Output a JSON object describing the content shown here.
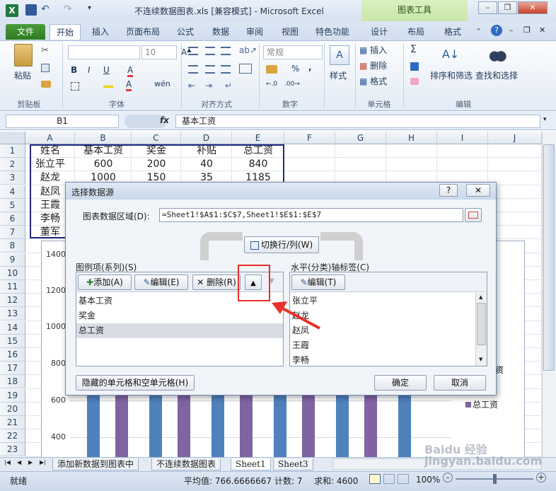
{
  "window": {
    "title": "不连续数据图表.xls  [兼容模式] - Microsoft Excel",
    "context_tab": "图表工具"
  },
  "ribbon_tabs": [
    "文件",
    "开始",
    "插入",
    "页面布局",
    "公式",
    "数据",
    "审阅",
    "视图",
    "特色功能",
    "设计",
    "布局",
    "格式"
  ],
  "ribbon": {
    "clipboard": {
      "paste": "粘贴",
      "label": "剪贴板"
    },
    "font": {
      "size": "10",
      "bold": "B",
      "italic": "I",
      "underline": "U",
      "label": "字体"
    },
    "align": {
      "label": "对齐方式"
    },
    "number": {
      "format": "常规",
      "percent": "%",
      "comma": ",",
      "label": "数字"
    },
    "styles": {
      "label": "样式"
    },
    "cells": {
      "insert": "插入",
      "delete": "删除",
      "format": "格式",
      "label": "单元格"
    },
    "editing": {
      "sum": "Σ",
      "sort": "排序和筛选",
      "find": "查找和选择",
      "label": "编辑"
    }
  },
  "formula_bar": {
    "name_box": "B1",
    "fx": "fx",
    "value": "基本工资"
  },
  "columns": [
    "A",
    "B",
    "C",
    "D",
    "E",
    "F",
    "G",
    "H",
    "I",
    "J"
  ],
  "rows": [
    "1",
    "2",
    "3",
    "4",
    "5",
    "6",
    "7",
    "8",
    "9",
    "10",
    "11",
    "12",
    "13",
    "14",
    "15",
    "16",
    "17",
    "18",
    "19",
    "20",
    "21",
    "22",
    "23"
  ],
  "table": {
    "header": [
      "姓名",
      "基本工资",
      "奖金",
      "补贴",
      "总工资"
    ],
    "rows": [
      [
        "张立平",
        "600",
        "200",
        "40",
        "840"
      ],
      [
        "赵龙",
        "1000",
        "150",
        "35",
        "1185"
      ],
      [
        "赵凤",
        "",
        "",
        "",
        ""
      ],
      [
        "王霞",
        "",
        "",
        "",
        ""
      ],
      [
        "李畅",
        "",
        "",
        "",
        ""
      ],
      [
        "董军",
        "",
        "",
        "",
        ""
      ]
    ]
  },
  "chart_data": {
    "type": "bar",
    "yticks": [
      "1400",
      "1200",
      "1000",
      "800",
      "600",
      "400"
    ],
    "legend_visible": [
      "资",
      "总工资"
    ],
    "colors": {
      "blue": "#4f81bd",
      "purple": "#8064a2"
    }
  },
  "dialog": {
    "title": "选择数据源",
    "help": "?",
    "close": "✕",
    "range_label": "图表数据区域(D):",
    "range_value": "=Sheet1!$A$1:$C$7,Sheet1!$E$1:$E$7",
    "switch_button": "切换行/列(W)",
    "legend_label": "图例项(系列)(S)",
    "add": "添加(A)",
    "edit": "编辑(E)",
    "remove": "删除(R)",
    "series": [
      "基本工资",
      "奖金",
      "总工资"
    ],
    "axis_label": "水平(分类)轴标签(C)",
    "axis_edit": "编辑(T)",
    "categories": [
      "张立平",
      "赵龙",
      "赵凤",
      "王霞",
      "李畅"
    ],
    "hidden_cells": "隐藏的单元格和空单元格(H)",
    "ok": "确定",
    "cancel": "取消"
  },
  "sheets": [
    "添加新数据到图表中",
    "不连续数据图表",
    "Sheet1",
    "Sheet3"
  ],
  "status": {
    "ready": "就绪",
    "average": "平均值: 766.6666667",
    "count": "计数: 7",
    "sum": "求和: 4600",
    "zoom": "100%"
  },
  "watermark": "Baidu 经验 jingyan.baidu.com"
}
